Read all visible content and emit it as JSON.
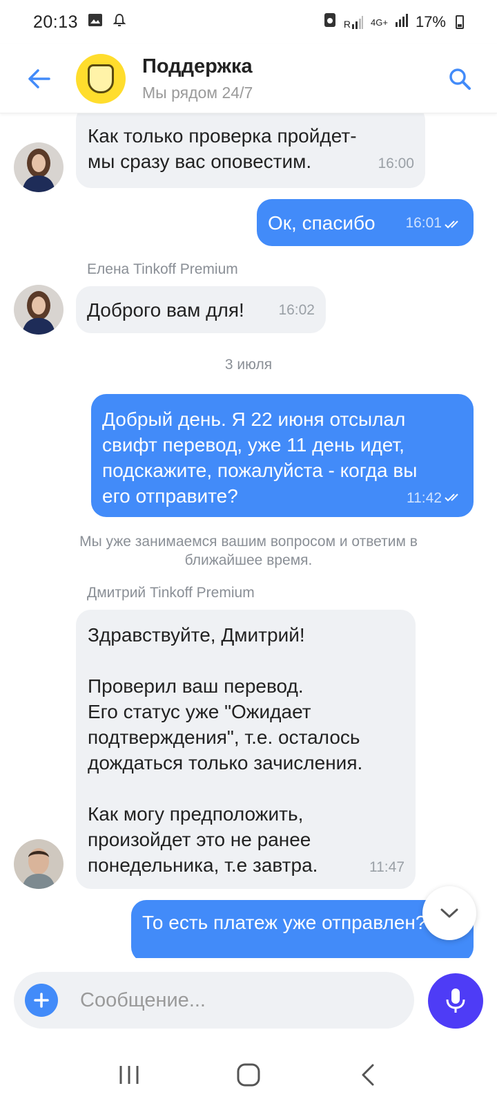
{
  "status_bar": {
    "time": "20:13",
    "battery": "17%",
    "network": "4G+",
    "roaming": "R"
  },
  "header": {
    "title": "Поддержка",
    "subtitle": "Мы рядом 24/7"
  },
  "messages": [
    {
      "dir": "in",
      "text_lines": [
        "Как только проверка пройдет-",
        "мы сразу вас оповестим."
      ],
      "time": "16:00"
    },
    {
      "dir": "out",
      "text": "Ок, спасибо",
      "time": "16:01"
    },
    {
      "sender": "Елена Tinkoff Premium"
    },
    {
      "dir": "in",
      "text": "Доброго вам для!",
      "time": "16:02"
    },
    {
      "date": "3 июля"
    },
    {
      "dir": "out",
      "text_lines": [
        "Добрый день. Я 22 июня отсылал",
        "свифт перевод, уже 11 день идет,",
        "подскажите, пожалуйста - когда вы",
        "его отправите?"
      ],
      "time": "11:42"
    },
    {
      "system": "Мы уже занимаемся вашим вопросом и ответим в ближайшее время."
    },
    {
      "sender": "Дмитрий Tinkoff Premium"
    },
    {
      "dir": "in",
      "text_lines": [
        "Здравствуйте, Дмитрий!",
        "",
        "Проверил ваш перевод.",
        "Его статус уже \"Ожидает",
        "подтверждения\", т.е. осталось",
        "дождаться только зачисления.",
        "",
        "Как могу предположить,",
        "произойдет это не ранее",
        "понедельника, т.е завтра."
      ],
      "time": "11:47"
    },
    {
      "dir": "out",
      "text": "То есть платеж уже отправлен?"
    }
  ],
  "input": {
    "placeholder": "Сообщение..."
  },
  "colors": {
    "outgoing_bubble": "#428bf9",
    "incoming_bubble": "#eff1f4",
    "accent": "#428bf9",
    "mic_button": "#4e3cf6",
    "logo": "#ffdd2d"
  },
  "icons": [
    "back-arrow-icon",
    "search-icon",
    "plus-icon",
    "microphone-icon",
    "chevron-down-icon",
    "double-check-icon",
    "recents-icon",
    "home-icon",
    "back-icon"
  ]
}
